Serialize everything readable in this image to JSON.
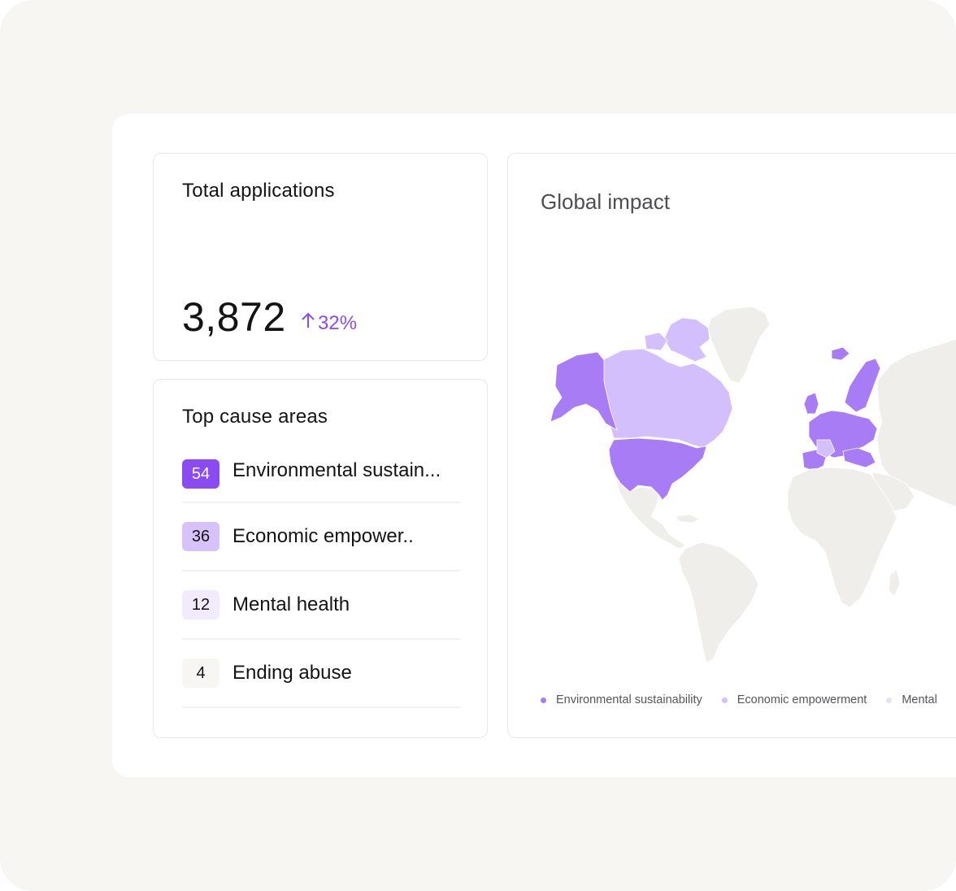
{
  "total": {
    "title": "Total applications",
    "value": "3,872",
    "delta": "32%",
    "accent": "#8a4cf2"
  },
  "causes": {
    "title": "Top cause areas",
    "items": [
      {
        "count": "54",
        "label": "Environmental sustain...",
        "badge_bg": "#8a4cf2",
        "badge_fg": "#ffffff"
      },
      {
        "count": "36",
        "label": "Economic empower..",
        "badge_bg": "#d8c2fa",
        "badge_fg": "#141414"
      },
      {
        "count": "12",
        "label": "Mental health",
        "badge_bg": "#f1ebfd",
        "badge_fg": "#141414"
      },
      {
        "count": "4",
        "label": "Ending abuse",
        "badge_bg": "#f7f6f3",
        "badge_fg": "#141414"
      }
    ]
  },
  "map": {
    "title": "Global impact",
    "colors": {
      "environmental": "#a77cf5",
      "economic": "#d3bffb",
      "mental": "#e6e1f1",
      "none": "#efeeea"
    },
    "legend": [
      {
        "label": "Environmental sustainability",
        "color": "#a77cf5"
      },
      {
        "label": "Economic empowerment",
        "color": "#d3bffb"
      },
      {
        "label": "Mental",
        "color": "#e6e1f1"
      }
    ]
  }
}
